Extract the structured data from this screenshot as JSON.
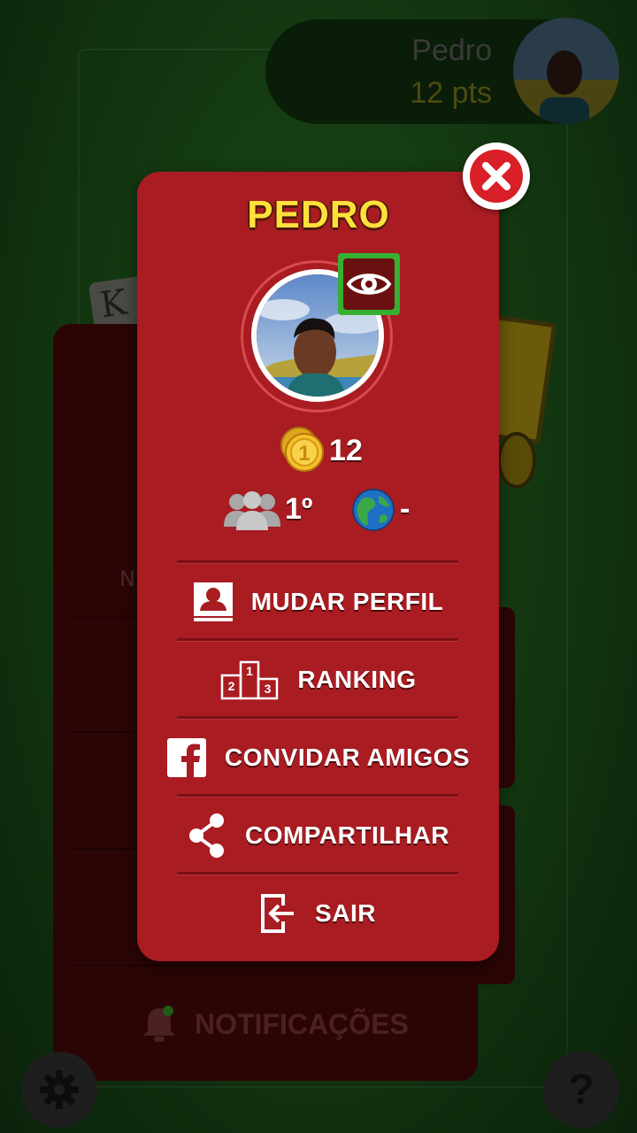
{
  "background": {
    "player": {
      "name": "Pedro",
      "points": "12 pts"
    },
    "card_letter": "K",
    "menu_partial_text": "N",
    "notifications_label": "NOTIFICAÇÕES",
    "help_label": "?"
  },
  "profile": {
    "title": "PEDRO",
    "coins": "12",
    "friends_rank": "1º",
    "world_rank": "-"
  },
  "menu": {
    "items": [
      {
        "label": "MUDAR PERFIL",
        "icon": "profile-icon"
      },
      {
        "label": "RANKING",
        "icon": "podium-icon"
      },
      {
        "label": "CONVIDAR AMIGOS",
        "icon": "facebook-icon"
      },
      {
        "label": "COMPARTILHAR",
        "icon": "share-icon"
      },
      {
        "label": "SAIR",
        "icon": "exit-icon"
      }
    ]
  },
  "colors": {
    "modal_bg": "#a91c22",
    "title_yellow": "#ffe03a",
    "close_red": "#d91f27",
    "eye_green": "#36b032"
  }
}
